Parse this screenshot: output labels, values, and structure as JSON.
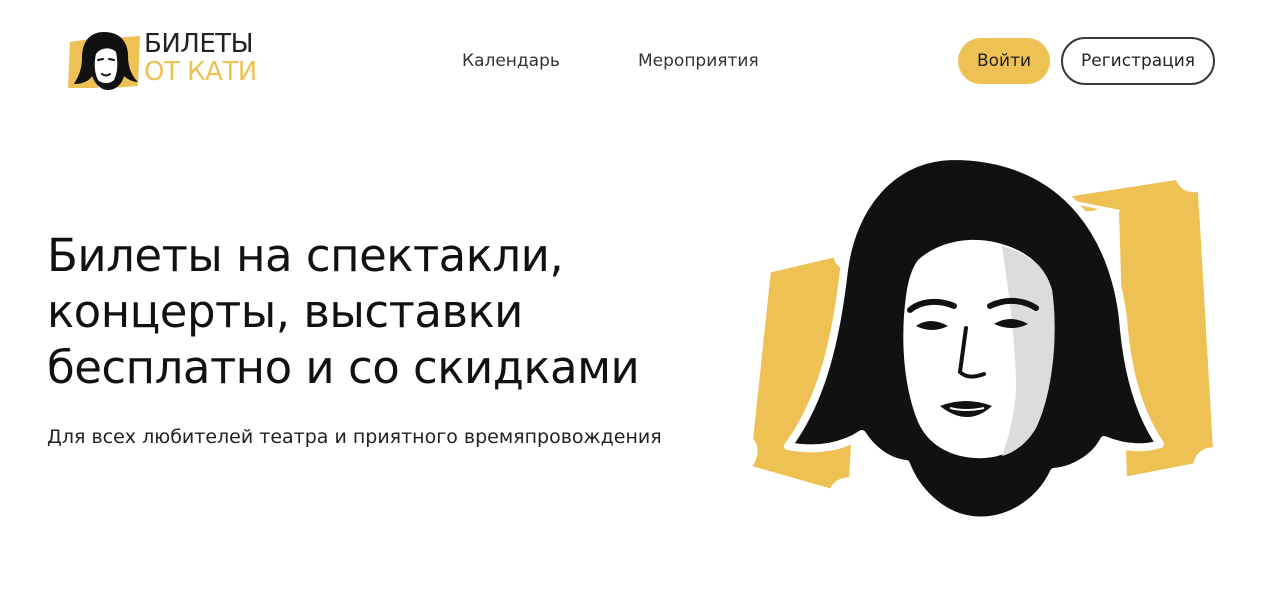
{
  "logo": {
    "line1": "БИЛЕТЫ",
    "line2": "ОТ КАТИ",
    "icon": "portrait-icon"
  },
  "nav": {
    "items": [
      {
        "label": "Календарь"
      },
      {
        "label": "Мероприятия"
      }
    ]
  },
  "auth": {
    "login_label": "Войти",
    "register_label": "Регистрация"
  },
  "hero": {
    "title_lines": [
      "Билеты на спектакли,",
      "концерты, выставки",
      "бесплатно и со скидками"
    ],
    "subtitle": "Для всех любителей театра и приятного времяпровождения"
  },
  "colors": {
    "accent": "#EEC155",
    "text": "#111111",
    "background": "#FFFFFF"
  }
}
